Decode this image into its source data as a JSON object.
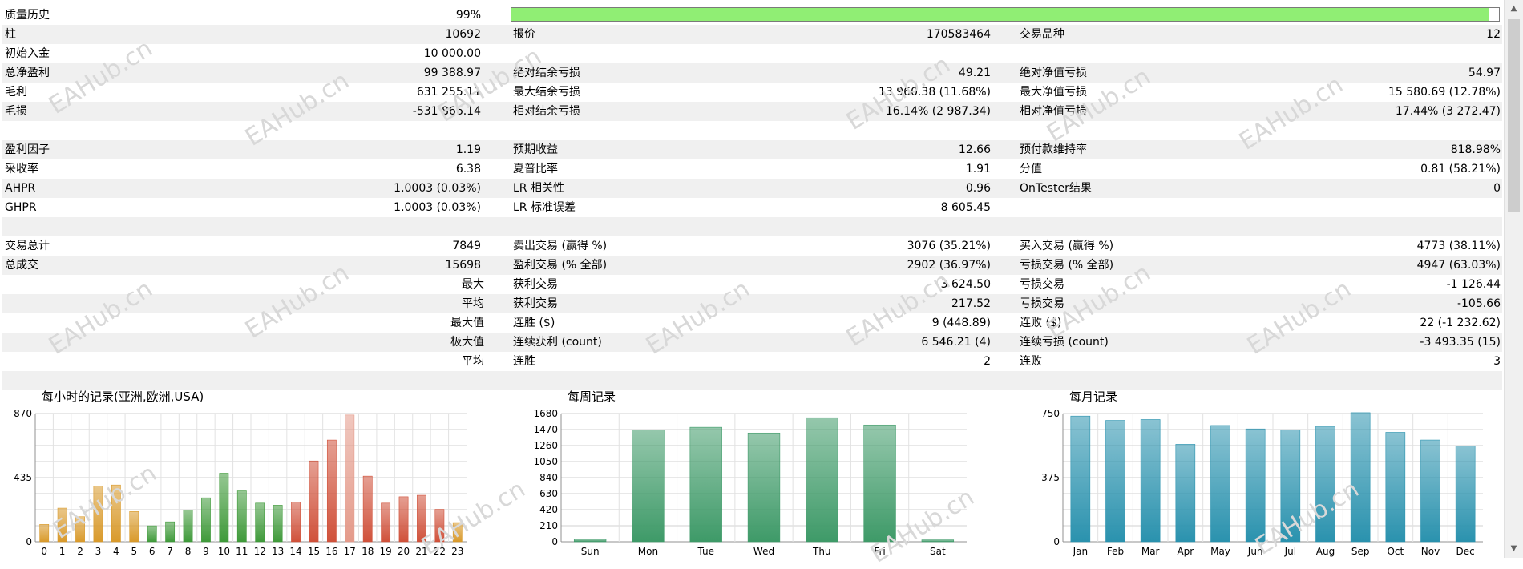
{
  "summary": {
    "quality_label": "质量历史",
    "quality_value": "99%",
    "quality_fraction": 0.99,
    "rows": [
      {
        "l1": "柱",
        "v1": "10692",
        "l2": "报价",
        "v2": "170583464",
        "l3": "交易品种",
        "v3": "12"
      },
      {
        "l1": "初始入金",
        "v1": "10 000.00",
        "l2": "",
        "v2": "",
        "l3": "",
        "v3": ""
      },
      {
        "l1": "总净盈利",
        "v1": "99 388.97",
        "l2": "绝对结余亏损",
        "v2": "49.21",
        "l3": "绝对净值亏损",
        "v3": "54.97"
      },
      {
        "l1": "毛利",
        "v1": "631 255.11",
        "l2": "最大结余亏损",
        "v2": "13 960.38 (11.68%)",
        "l3": "最大净值亏损",
        "v3": "15 580.69 (12.78%)"
      },
      {
        "l1": "毛损",
        "v1": "-531 866.14",
        "l2": "相对结余亏损",
        "v2": "16.14% (2 987.34)",
        "l3": "相对净值亏损",
        "v3": "17.44% (3 272.47)"
      },
      {
        "l1": "",
        "v1": "",
        "l2": "",
        "v2": "",
        "l3": "",
        "v3": ""
      },
      {
        "l1": "盈利因子",
        "v1": "1.19",
        "l2": "预期收益",
        "v2": "12.66",
        "l3": "预付款维持率",
        "v3": "818.98%"
      },
      {
        "l1": "采收率",
        "v1": "6.38",
        "l2": "夏普比率",
        "v2": "1.91",
        "l3": "分值",
        "v3": "0.81 (58.21%)"
      },
      {
        "l1": "AHPR",
        "v1": "1.0003 (0.03%)",
        "l2": "LR 相关性",
        "v2": "0.96",
        "l3": "OnTester结果",
        "v3": "0"
      },
      {
        "l1": "GHPR",
        "v1": "1.0003 (0.03%)",
        "l2": "LR 标准误差",
        "v2": "8 605.45",
        "l3": "",
        "v3": ""
      },
      {
        "l1": "",
        "v1": "",
        "l2": "",
        "v2": "",
        "l3": "",
        "v3": ""
      },
      {
        "l1": "交易总计",
        "v1": "7849",
        "l2": "卖出交易 (赢得 %)",
        "v2": "3076 (35.21%)",
        "l3": "买入交易 (赢得 %)",
        "v3": "4773 (38.11%)"
      },
      {
        "l1": "总成交",
        "v1": "15698",
        "l2": "盈利交易 (% 全部)",
        "v2": "2902 (36.97%)",
        "l3": "亏损交易 (% 全部)",
        "v3": "4947 (63.03%)"
      },
      {
        "r1": "最大",
        "l2": "获利交易",
        "v2": "3 624.50",
        "l3": "亏损交易",
        "v3": "-1 126.44"
      },
      {
        "r1": "平均",
        "l2": "获利交易",
        "v2": "217.52",
        "l3": "亏损交易",
        "v3": "-105.66"
      },
      {
        "r1": "最大值",
        "l2": "连胜 ($)",
        "v2": "9 (448.89)",
        "l3": "连败 ($)",
        "v3": "22 (-1 232.62)"
      },
      {
        "r1": "极大值",
        "l2": "连续获利 (count)",
        "v2": "6 546.21 (4)",
        "l3": "连续亏损 (count)",
        "v3": "-3 493.35 (15)"
      },
      {
        "r1": "平均",
        "l2": "连胜",
        "v2": "2",
        "l3": "连败",
        "v3": "3"
      },
      {
        "l1": "",
        "v1": "",
        "l2": "",
        "v2": "",
        "l3": "",
        "v3": ""
      }
    ]
  },
  "watermark_text": "EAHub.cn",
  "icons": {
    "scroll_up": "chevron-up-icon",
    "scroll_down": "chevron-down-icon"
  },
  "chart_data": [
    {
      "type": "bar",
      "title": "每小时的记录(亚洲,欧洲,USA)",
      "categories": [
        "0",
        "1",
        "2",
        "3",
        "4",
        "5",
        "6",
        "7",
        "8",
        "9",
        "10",
        "11",
        "12",
        "13",
        "14",
        "15",
        "16",
        "17",
        "18",
        "19",
        "20",
        "21",
        "22",
        "23"
      ],
      "values": [
        118,
        228,
        170,
        378,
        385,
        205,
        108,
        135,
        215,
        298,
        465,
        345,
        262,
        248,
        270,
        548,
        690,
        860,
        445,
        262,
        305,
        315,
        220,
        130
      ],
      "yticks": [
        "0",
        "435",
        "870"
      ],
      "ylim": [
        0,
        870
      ],
      "colors": [
        "#d99a2b",
        "#d99a2b",
        "#d99a2b",
        "#d99a2b",
        "#d99a2b",
        "#d99a2b",
        "#3f9a3a",
        "#3f9a3a",
        "#3f9a3a",
        "#3f9a3a",
        "#3f9a3a",
        "#3f9a3a",
        "#3f9a3a",
        "#3f9a3a",
        "#d0513a",
        "#d0513a",
        "#d0513a",
        "#e49a8a",
        "#d0513a",
        "#d0513a",
        "#d0513a",
        "#d0513a",
        "#d0513a",
        "#d99a2b"
      ]
    },
    {
      "type": "bar",
      "title": "每周记录",
      "categories": [
        "Sun",
        "Mon",
        "Tue",
        "Wed",
        "Thu",
        "Fri",
        "Sat"
      ],
      "values": [
        35,
        1465,
        1500,
        1425,
        1625,
        1530,
        25
      ],
      "yticks": [
        "0",
        "210",
        "420",
        "630",
        "840",
        "1050",
        "1260",
        "1470",
        "1680"
      ],
      "ylim": [
        0,
        1680
      ],
      "colors": [
        "#3e9a68"
      ]
    },
    {
      "type": "bar",
      "title": "每月记录",
      "categories": [
        "Jan",
        "Feb",
        "Mar",
        "Apr",
        "May",
        "Jun",
        "Jul",
        "Aug",
        "Sep",
        "Oct",
        "Nov",
        "Dec"
      ],
      "values": [
        735,
        710,
        715,
        570,
        680,
        660,
        655,
        675,
        755,
        640,
        595,
        560
      ],
      "yticks": [
        "0",
        "375",
        "750"
      ],
      "ylim": [
        0,
        750
      ],
      "colors": [
        "#2a92ae"
      ]
    }
  ]
}
